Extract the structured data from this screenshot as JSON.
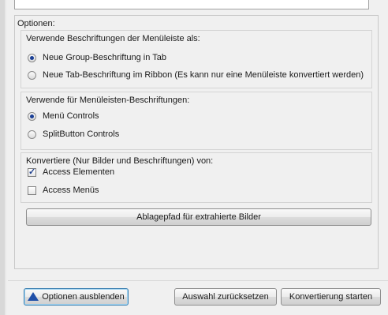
{
  "options": {
    "title": "Optionen:",
    "group1": {
      "label": "Verwende Beschriftungen der Menüleiste als:",
      "items": [
        {
          "label": "Neue Group-Beschriftung in Tab",
          "selected": true
        },
        {
          "label": "Neue Tab-Beschriftung im Ribbon (Es kann nur eine Menüleiste konvertiert werden)",
          "selected": false
        }
      ]
    },
    "group2": {
      "label": "Verwende für Menüleisten-Beschriftungen:",
      "items": [
        {
          "label": "Menü Controls",
          "selected": true
        },
        {
          "label": "SplitButton Controls",
          "selected": false
        }
      ]
    },
    "group3": {
      "label": "Konvertiere (Nur Bilder und Beschriftungen) von:",
      "items": [
        {
          "label": "Access Elementen",
          "checked": true
        },
        {
          "label": "Access Menüs",
          "checked": false
        }
      ]
    },
    "path_button": "Ablagepfad für extrahierte Bilder"
  },
  "footer": {
    "hide_options": "Optionen ausblenden",
    "reset": "Auswahl zurücksetzen",
    "start": "Konvertierung starten"
  },
  "colors": {
    "accent": "#1f4fa8"
  },
  "icons": {
    "hide_options": "warning-triangle-icon"
  }
}
